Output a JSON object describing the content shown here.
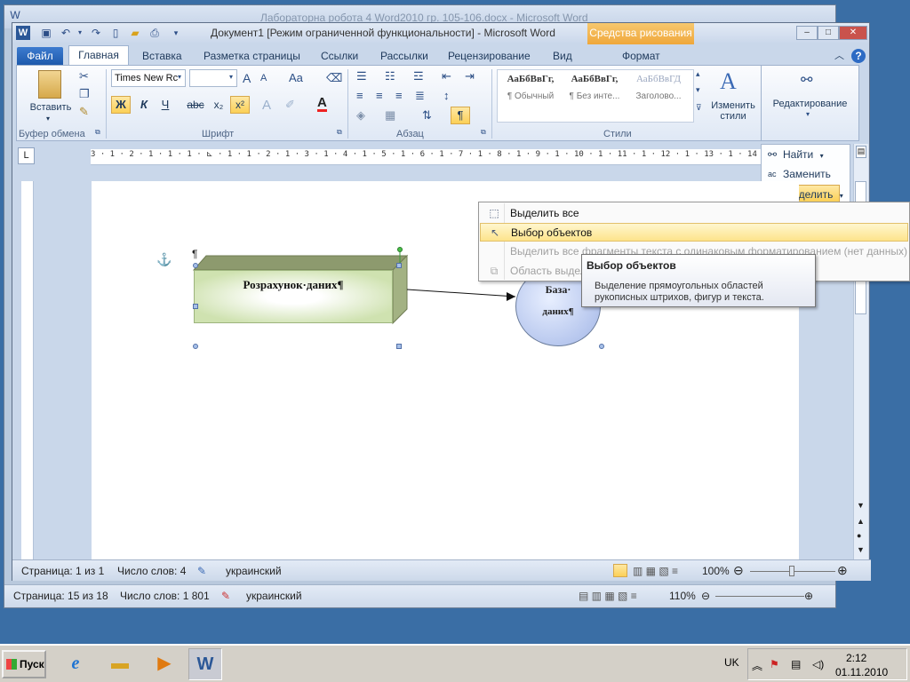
{
  "back_window": {
    "title": "Лабораторна робота 4 Word2010 гр. 105-106.docx - Microsoft Word",
    "status": {
      "page": "Страница: 15 из 18",
      "words": "Число слов: 1 801",
      "language": "украинский",
      "zoom": "110%"
    }
  },
  "window": {
    "title": "Документ1 [Режим ограниченной функциональности] - Microsoft Word",
    "context_title": "Средства рисования",
    "controls": {
      "minimize": "–",
      "maximize": "□",
      "close": "✕"
    }
  },
  "tabs": [
    "Файл",
    "Главная",
    "Вставка",
    "Разметка страницы",
    "Ссылки",
    "Рассылки",
    "Рецензирование",
    "Вид",
    "Формат"
  ],
  "active_tab": "Главная",
  "ribbon": {
    "clipboard": {
      "paste": "Вставить",
      "label": "Буфер обмена"
    },
    "font": {
      "name": "Times New Rc",
      "size": "",
      "bold": "Ж",
      "italic": "К",
      "underline": "Ч",
      "strike": "abc",
      "subscript": "x₂",
      "superscript": "x²",
      "grow": "A",
      "shrink": "A",
      "case": "Aa",
      "label": "Шрифт"
    },
    "paragraph": {
      "pilcrow": "¶",
      "label": "Абзац"
    },
    "styles": {
      "items": [
        {
          "sample": "АаБбВвГг,",
          "name": "¶ Обычный"
        },
        {
          "sample": "АаБбВвГг,",
          "name": "¶ Без инте..."
        },
        {
          "sample": "АаБбВвГД",
          "name": "Заголово..."
        }
      ],
      "change": "Изменить стили",
      "label": "Стили"
    },
    "editing": {
      "label": "Редактирование",
      "find": "Найти",
      "replace": "Заменить",
      "select": "Выделить"
    }
  },
  "ruler": "3 · 1 · 2 · 1 · 1 · 1 · ⊾ · 1 · 1 · 2 · 1 · 3 · 1 · 4 · 1 · 5 · 1 · 6 · 1 · 7 · 1 · 8 · 1 · 9 · 1 · 10 · 1 · 11 · 1 · 12 · 1 · 13 · 1 · 14 · 1 · 15 · 1 · 16 · 1",
  "document": {
    "pilcrow": "¶",
    "anchor": "⚓",
    "box_text": "Розрахунок·даних¶",
    "circle_line1": "База·",
    "circle_line2": "даних¶"
  },
  "select_menu": {
    "items": [
      {
        "label": "Выделить все",
        "icon": "select-all-icon",
        "disabled": false
      },
      {
        "label": "Выбор объектов",
        "icon": "cursor-arrow-icon",
        "disabled": false,
        "highlighted": true
      },
      {
        "label": "Выделить все фрагменты текста с одинаковым форматированием (нет данных)",
        "icon": "",
        "disabled": true
      },
      {
        "label": "Область выдел",
        "icon": "selection-pane-icon",
        "disabled": true
      }
    ]
  },
  "tooltip": {
    "title": "Выбор объектов",
    "body": "Выделение прямоугольных областей рукописных штрихов, фигур и текста."
  },
  "status": {
    "page": "Страница: 1 из 1",
    "words": "Число слов: 4",
    "language": "украинский",
    "zoom": "100%"
  },
  "taskbar": {
    "start": "Пуск",
    "lang": "UK",
    "time": "2:12",
    "date": "01.11.2010"
  },
  "colors": {
    "file_tab": "#1e5aac",
    "context_tab": "#efa73b",
    "menu_highlight": "#fde48b",
    "desktop": "#3a6ea5"
  }
}
